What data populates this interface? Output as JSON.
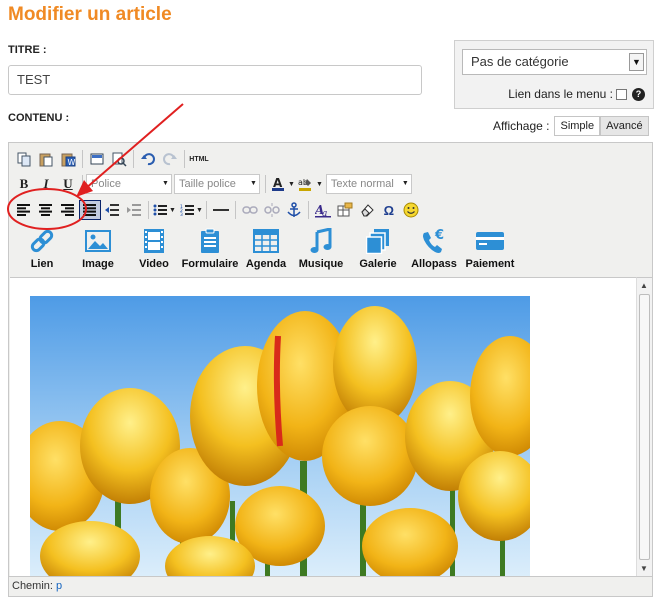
{
  "page": {
    "title": "Modifier un article"
  },
  "form": {
    "title_label": "TITRE :",
    "title_value": "TEST",
    "content_label": "CONTENU :"
  },
  "category": {
    "selected": "Pas de catégorie",
    "menu_link_label": "Lien dans le menu :",
    "help_icon_text": "?"
  },
  "display": {
    "label": "Affichage :",
    "simple": "Simple",
    "advanced": "Avancé"
  },
  "toolbar": {
    "html_label": "HTML",
    "bold": "B",
    "italic": "I",
    "underline": "U",
    "font_select": "Police",
    "size_select": "Taille police",
    "format_select": "Texte normal",
    "font_color_glyph": "A",
    "omega_glyph": "Ω"
  },
  "media_bar": {
    "items": [
      {
        "label": "Lien",
        "icon": "link-icon"
      },
      {
        "label": "Image",
        "icon": "image-icon"
      },
      {
        "label": "Video",
        "icon": "video-icon"
      },
      {
        "label": "Formulaire",
        "icon": "form-icon"
      },
      {
        "label": "Agenda",
        "icon": "calendar-icon"
      },
      {
        "label": "Musique",
        "icon": "music-icon"
      },
      {
        "label": "Galerie",
        "icon": "gallery-icon"
      },
      {
        "label": "Allopass",
        "icon": "phone-euro-icon"
      },
      {
        "label": "Paiement",
        "icon": "card-icon"
      }
    ]
  },
  "status": {
    "path_label": "Chemin:",
    "path_value": "p"
  },
  "colors": {
    "title_orange": "#f08a24",
    "icon_blue": "#2d8fd5",
    "annotation_red": "#e02020"
  }
}
